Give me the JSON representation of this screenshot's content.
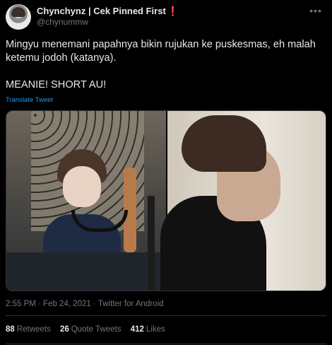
{
  "user": {
    "display_name": "Chynchynz | Cek Pinned First",
    "exclamation": "❗",
    "handle": "@chynummw"
  },
  "more_icon": "more-horizontal-icon",
  "tweet": {
    "line1": "Mingyu menemani papahnya bikin rujukan ke puskesmas, eh malah ketemu jodoh (katanya).",
    "line2": "MEANIE! SHORT AU!"
  },
  "translate_label": "Translate Tweet",
  "meta": {
    "time_date_source": "2:55 PM · Feb 24, 2021 · Twitter for Android"
  },
  "stats": {
    "retweets": {
      "count": "88",
      "label": "Retweets"
    },
    "quotes": {
      "count": "26",
      "label": "Quote Tweets"
    },
    "likes": {
      "count": "412",
      "label": "Likes"
    }
  },
  "colors": {
    "background": "#000000",
    "link": "#1d9bf0",
    "secondary_text": "#71767b",
    "primary_text": "#e7e9ea"
  }
}
